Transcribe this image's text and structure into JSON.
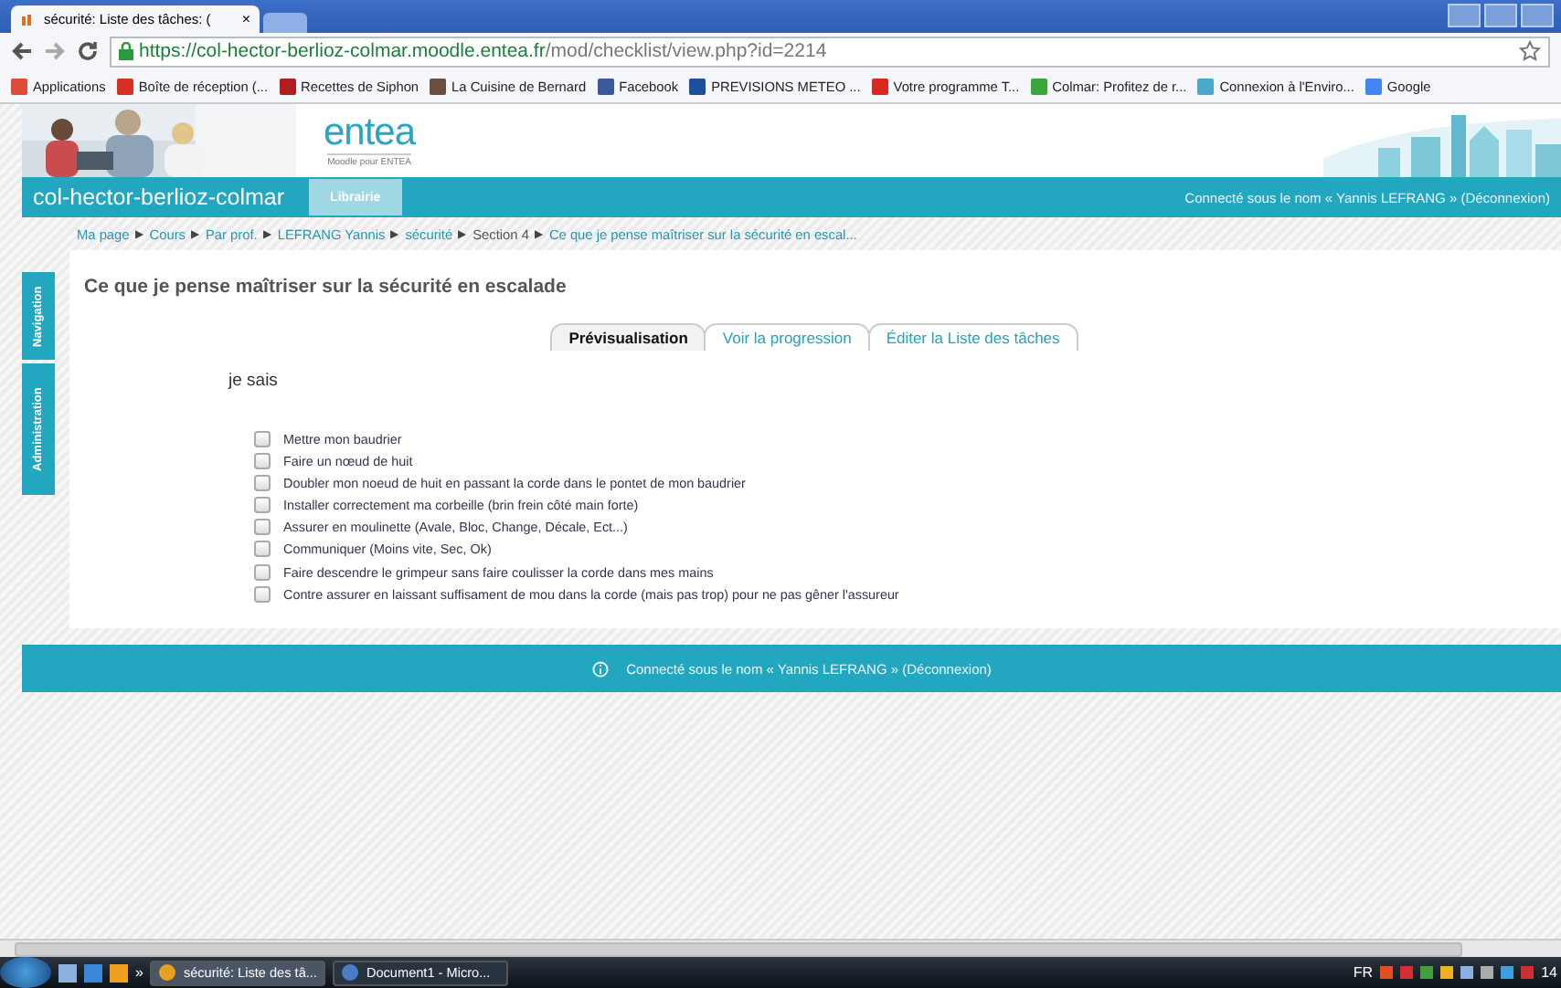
{
  "browser": {
    "tab_title": "sécurité: Liste des tâches: (",
    "tab_close": "×",
    "url_host": "https://col-hector-berlioz-colmar.moodle.entea.fr",
    "url_path": "/mod/checklist/view.php?id=2214",
    "bookmarks": [
      {
        "label": "Applications",
        "color": "#e04a3a"
      },
      {
        "label": "Boîte de réception (...",
        "color": "#d93025"
      },
      {
        "label": "Recettes de Siphon",
        "color": "#b01e1e"
      },
      {
        "label": "La Cuisine de Bernard",
        "color": "#6b5040"
      },
      {
        "label": "Facebook",
        "color": "#3b5998"
      },
      {
        "label": "PREVISIONS METEO ...",
        "color": "#1c4f9c"
      },
      {
        "label": "Votre programme T...",
        "color": "#d8281e"
      },
      {
        "label": "Colmar: Profitez de r...",
        "color": "#3aa53a"
      },
      {
        "label": "Connexion à l'Enviro...",
        "color": "#4aa9c9"
      },
      {
        "label": "Google",
        "color": "#4285f4"
      }
    ]
  },
  "header": {
    "logo": "entea",
    "logo_sub": "Moodle pour ENTEA",
    "site_name": "col-hector-berlioz-colmar",
    "menu": [
      "Librairie"
    ],
    "login": "Connecté sous le nom « Yannis LEFRANG » (Déconnexion)"
  },
  "breadcrumb_separator": "▶",
  "breadcrumb": [
    {
      "label": "Ma page",
      "link": true
    },
    {
      "label": "Cours",
      "link": true
    },
    {
      "label": "Par prof.",
      "link": true
    },
    {
      "label": "LEFRANG Yannis",
      "link": true
    },
    {
      "label": "sécurité",
      "link": true
    },
    {
      "label": "Section 4",
      "link": false
    },
    {
      "label": "Ce que je pense maîtriser sur la sécurité en escal...",
      "link": true
    }
  ],
  "side_tabs": [
    "Navigation",
    "Administration"
  ],
  "checklist": {
    "title": "Ce que je pense maîtriser sur la sécurité en escalade",
    "tabs": [
      {
        "label": "Prévisualisation",
        "selected": true
      },
      {
        "label": "Voir la progression",
        "selected": false
      },
      {
        "label": "Éditer la Liste des tâches",
        "selected": false
      }
    ],
    "heading": "je sais",
    "items": [
      {
        "label": "Mettre mon baudrier",
        "checked": false
      },
      {
        "label": "Faire un nœud de huit",
        "checked": false
      },
      {
        "label": "Doubler mon noeud de huit en passant la corde dans le pontet de mon baudrier",
        "checked": false
      },
      {
        "label": "Installer correctement ma corbeille (brin frein côté main forte)",
        "checked": false
      },
      {
        "label": "Assurer en moulinette (Avale, Bloc, Change, Décale, Ect...)",
        "checked": false
      },
      {
        "label": "Communiquer (Moins vite, Sec, Ok)",
        "checked": false
      },
      {
        "label": "Faire descendre le grimpeur sans faire coulisser la corde dans mes mains",
        "checked": false
      },
      {
        "label": "Contre assurer en laissant suffisament de mou dans la corde (mais pas trop) pour ne pas gêner l'assureur",
        "checked": false
      }
    ]
  },
  "footer": {
    "login": "Connecté sous le nom « Yannis LEFRANG » (Déconnexion)"
  },
  "taskbar": {
    "chevron": "»",
    "windows": [
      {
        "label": "sécurité: Liste des tâ...",
        "selected": true
      },
      {
        "label": "Document1 - Micro...",
        "selected": false
      }
    ],
    "language": "FR",
    "clock": "14"
  }
}
